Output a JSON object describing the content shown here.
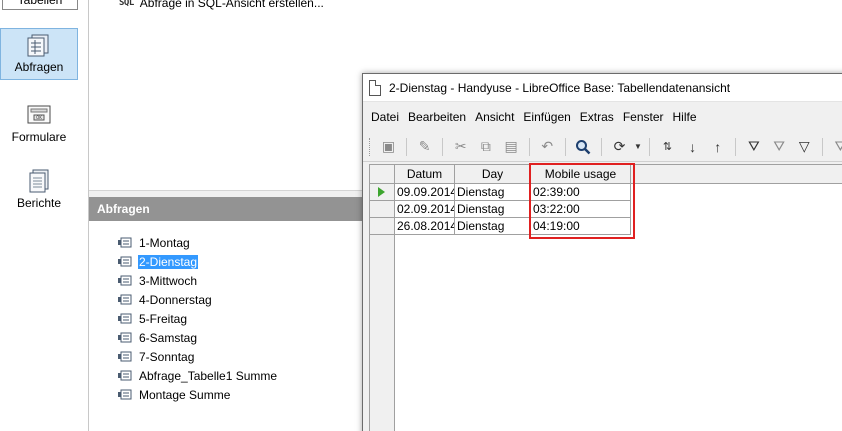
{
  "sidebar": {
    "top_tab": "Tabellen",
    "items": [
      {
        "label": "Abfragen",
        "icon": "queries-icon",
        "selected": true
      },
      {
        "label": "Formulare",
        "icon": "forms-icon",
        "selected": false
      },
      {
        "label": "Berichte",
        "icon": "reports-icon",
        "selected": false
      }
    ]
  },
  "tasks": {
    "sql_icon_text": "SQL",
    "create_sql_view": "Abfrage in SQL-Ansicht erstellen..."
  },
  "queries_panel": {
    "title": "Abfragen",
    "items": [
      "1-Montag",
      "2-Dienstag",
      "3-Mittwoch",
      "4-Donnerstag",
      "5-Freitag",
      "6-Samstag",
      "7-Sonntag",
      "Abfrage_Tabelle1 Summe",
      "Montage Summe"
    ],
    "selected_index": 1
  },
  "window": {
    "title": "2-Dienstag - Handyuse - LibreOffice Base: Tabellendatenansicht",
    "menu": [
      "Datei",
      "Bearbeiten",
      "Ansicht",
      "Einfügen",
      "Extras",
      "Fenster",
      "Hilfe"
    ],
    "toolbar_icons": [
      "save-icon",
      "edit-icon",
      "cut-icon",
      "copy-icon",
      "paste-icon",
      "undo-icon",
      "find-icon",
      "refresh-icon",
      "dropdown-arrow-icon",
      "sort-icon",
      "sort-ascending-icon",
      "sort-descending-icon",
      "autofilter-icon",
      "standard-filter-icon",
      "apply-filter-icon",
      "reset-filter-icon"
    ],
    "grid": {
      "columns": [
        "Datum",
        "Day",
        "Mobile usage"
      ],
      "rows": [
        [
          "09.09.2014",
          "Dienstag",
          "02:39:00"
        ],
        [
          "02.09.2014",
          "Dienstag",
          "03:22:00"
        ],
        [
          "26.08.2014",
          "Dienstag",
          "04:19:00"
        ]
      ],
      "current_row": 0,
      "highlight_color": "#e02020"
    }
  },
  "colors": {
    "selection": "#3399ff",
    "sidebar_selected": "#cce4f7",
    "panel_header": "#939393"
  }
}
